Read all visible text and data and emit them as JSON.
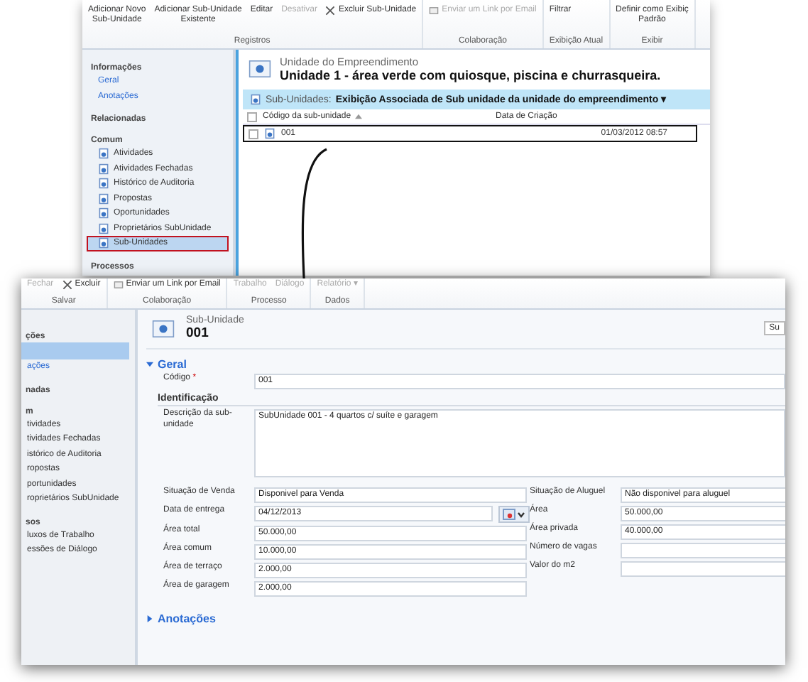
{
  "top_window": {
    "ribbon": {
      "groups": [
        {
          "label": "Registros",
          "buttons": [
            {
              "label": "Adicionar Novo\nSub-Unidade",
              "disabled": false,
              "kind": "plain"
            },
            {
              "label": "Adicionar Sub-Unidade\nExistente",
              "disabled": false,
              "kind": "plain"
            },
            {
              "label": "Editar",
              "disabled": false,
              "kind": "plain"
            },
            {
              "label": "Desativar",
              "disabled": true,
              "kind": "plain"
            },
            {
              "label": "Excluir Sub-Unidade",
              "disabled": false,
              "kind": "delete"
            }
          ]
        },
        {
          "label": "Colaboração",
          "buttons": [
            {
              "label": "Enviar um Link por Email",
              "disabled": true,
              "kind": "email"
            }
          ]
        },
        {
          "label": "Exibição Atual",
          "buttons": [
            {
              "label": "Filtrar",
              "disabled": false,
              "kind": "plain"
            }
          ]
        },
        {
          "label": "Exibir",
          "buttons": [
            {
              "label": "Definir como Exibiç\nPadrão",
              "disabled": false,
              "kind": "plain"
            }
          ]
        }
      ]
    },
    "nav": [
      {
        "title": "Informações",
        "items": [
          {
            "label": "Geral",
            "selected": false,
            "kind": "link"
          },
          {
            "label": "Anotações",
            "selected": false,
            "kind": "link"
          }
        ]
      },
      {
        "title": "Relacionadas"
      },
      {
        "title": "Comum",
        "items": [
          {
            "label": "Atividades",
            "selected": false,
            "kind": "entity"
          },
          {
            "label": "Atividades Fechadas",
            "selected": false,
            "kind": "entity"
          },
          {
            "label": "Histórico de Auditoria",
            "selected": false,
            "kind": "entity"
          },
          {
            "label": "Propostas",
            "selected": false,
            "kind": "entity"
          },
          {
            "label": "Oportunidades",
            "selected": false,
            "kind": "entity"
          },
          {
            "label": "Proprietários SubUnidade",
            "selected": false,
            "kind": "entity"
          },
          {
            "label": "Sub-Unidades",
            "selected": true,
            "kind": "entity"
          }
        ]
      },
      {
        "title": "Processos"
      }
    ],
    "record": {
      "entity": "Unidade do Empreendimento",
      "title": "Unidade 1 - área verde com quiosque, piscina e churrasqueira."
    },
    "view": {
      "entity_label": "Sub-Unidades:",
      "view_name": "Exibição Associada de Sub unidade da unidade do empreendimento",
      "caret": "▾",
      "all_checked": false,
      "columns": [
        "Código da sub-unidade",
        "Data de Criação"
      ],
      "rows": [
        {
          "cells": [
            "001",
            "01/03/2012 08:57"
          ],
          "checked": false,
          "highlighted": true
        }
      ]
    }
  },
  "bottom_window": {
    "ribbon": {
      "groups": [
        {
          "label": "Salvar",
          "buttons": [
            {
              "label": "Fechar",
              "disabled": true,
              "kind": "plain"
            },
            {
              "label": "Excluir",
              "disabled": false,
              "kind": "delete"
            }
          ]
        },
        {
          "label": "Colaboração",
          "buttons": [
            {
              "label": "Enviar um Link por Email",
              "disabled": false,
              "kind": "email"
            }
          ]
        },
        {
          "label": "Processo",
          "buttons": [
            {
              "label": "Trabalho",
              "disabled": true,
              "kind": "plain"
            },
            {
              "label": "Diálogo",
              "disabled": true,
              "kind": "plain"
            }
          ]
        },
        {
          "label": "Dados",
          "buttons": [
            {
              "label": "Relatório ▾",
              "disabled": true,
              "kind": "plain"
            }
          ]
        }
      ]
    },
    "nav": [
      {
        "title": "ções",
        "items": [
          {
            "selected": true,
            "kind": "link"
          },
          {
            "label": "ações",
            "selected": false,
            "kind": "link"
          }
        ]
      },
      {
        "title": "nadas"
      },
      {
        "title": "m",
        "items": [
          {
            "label": "tividades",
            "selected": false,
            "kind": "plain"
          },
          {
            "label": "tividades Fechadas",
            "selected": false,
            "kind": "plain"
          },
          {
            "label": "istórico de Auditoria",
            "selected": false,
            "kind": "plain"
          },
          {
            "label": "ropostas",
            "selected": false,
            "kind": "plain"
          },
          {
            "label": "portunidades",
            "selected": false,
            "kind": "plain"
          },
          {
            "label": "roprietários SubUnidade",
            "selected": false,
            "kind": "plain"
          }
        ]
      },
      {
        "title": "sos",
        "items": [
          {
            "label": "luxos de Trabalho",
            "selected": false,
            "kind": "plain"
          },
          {
            "label": "essões de Diálogo",
            "selected": false,
            "kind": "plain"
          }
        ]
      }
    ],
    "header": {
      "entity": "Sub-Unidade",
      "title": "001",
      "side_button": "Su"
    },
    "section": {
      "title": "Geral",
      "expanded": true
    },
    "code_field": {
      "label": "Código",
      "required_mark": "*",
      "value": "001"
    },
    "subsection": "Identificação",
    "description": {
      "label": "Descrição da sub-unidade",
      "value": "SubUnidade 001 - 4 quartos c/ suíte e garagem"
    },
    "fields_left": [
      {
        "label": "Situação de Venda",
        "value": "Disponivel para Venda",
        "kind": "text"
      },
      {
        "label": "Data de entrega",
        "value": "04/12/2013",
        "kind": "date"
      },
      {
        "label": "Área total",
        "value": "50.000,00",
        "kind": "text"
      },
      {
        "label": "Área comum",
        "value": "10.000,00",
        "kind": "text"
      },
      {
        "label": "Área de terraço",
        "value": "2.000,00",
        "kind": "text"
      },
      {
        "label": "Área de garagem",
        "value": "2.000,00",
        "kind": "text"
      }
    ],
    "fields_right": [
      {
        "label": "Situação de Aluguel",
        "value": "Não disponivel para aluguel",
        "kind": "text"
      },
      {
        "label": "Área",
        "value": "50.000,00",
        "kind": "text"
      },
      {
        "label": "Área privada",
        "value": "40.000,00",
        "kind": "text"
      },
      {
        "label": "Número de vagas",
        "kind": "text"
      },
      {
        "label": "Valor do m2",
        "kind": "text"
      }
    ],
    "collapsed_section": {
      "title": "Anotações",
      "expanded": false
    }
  }
}
